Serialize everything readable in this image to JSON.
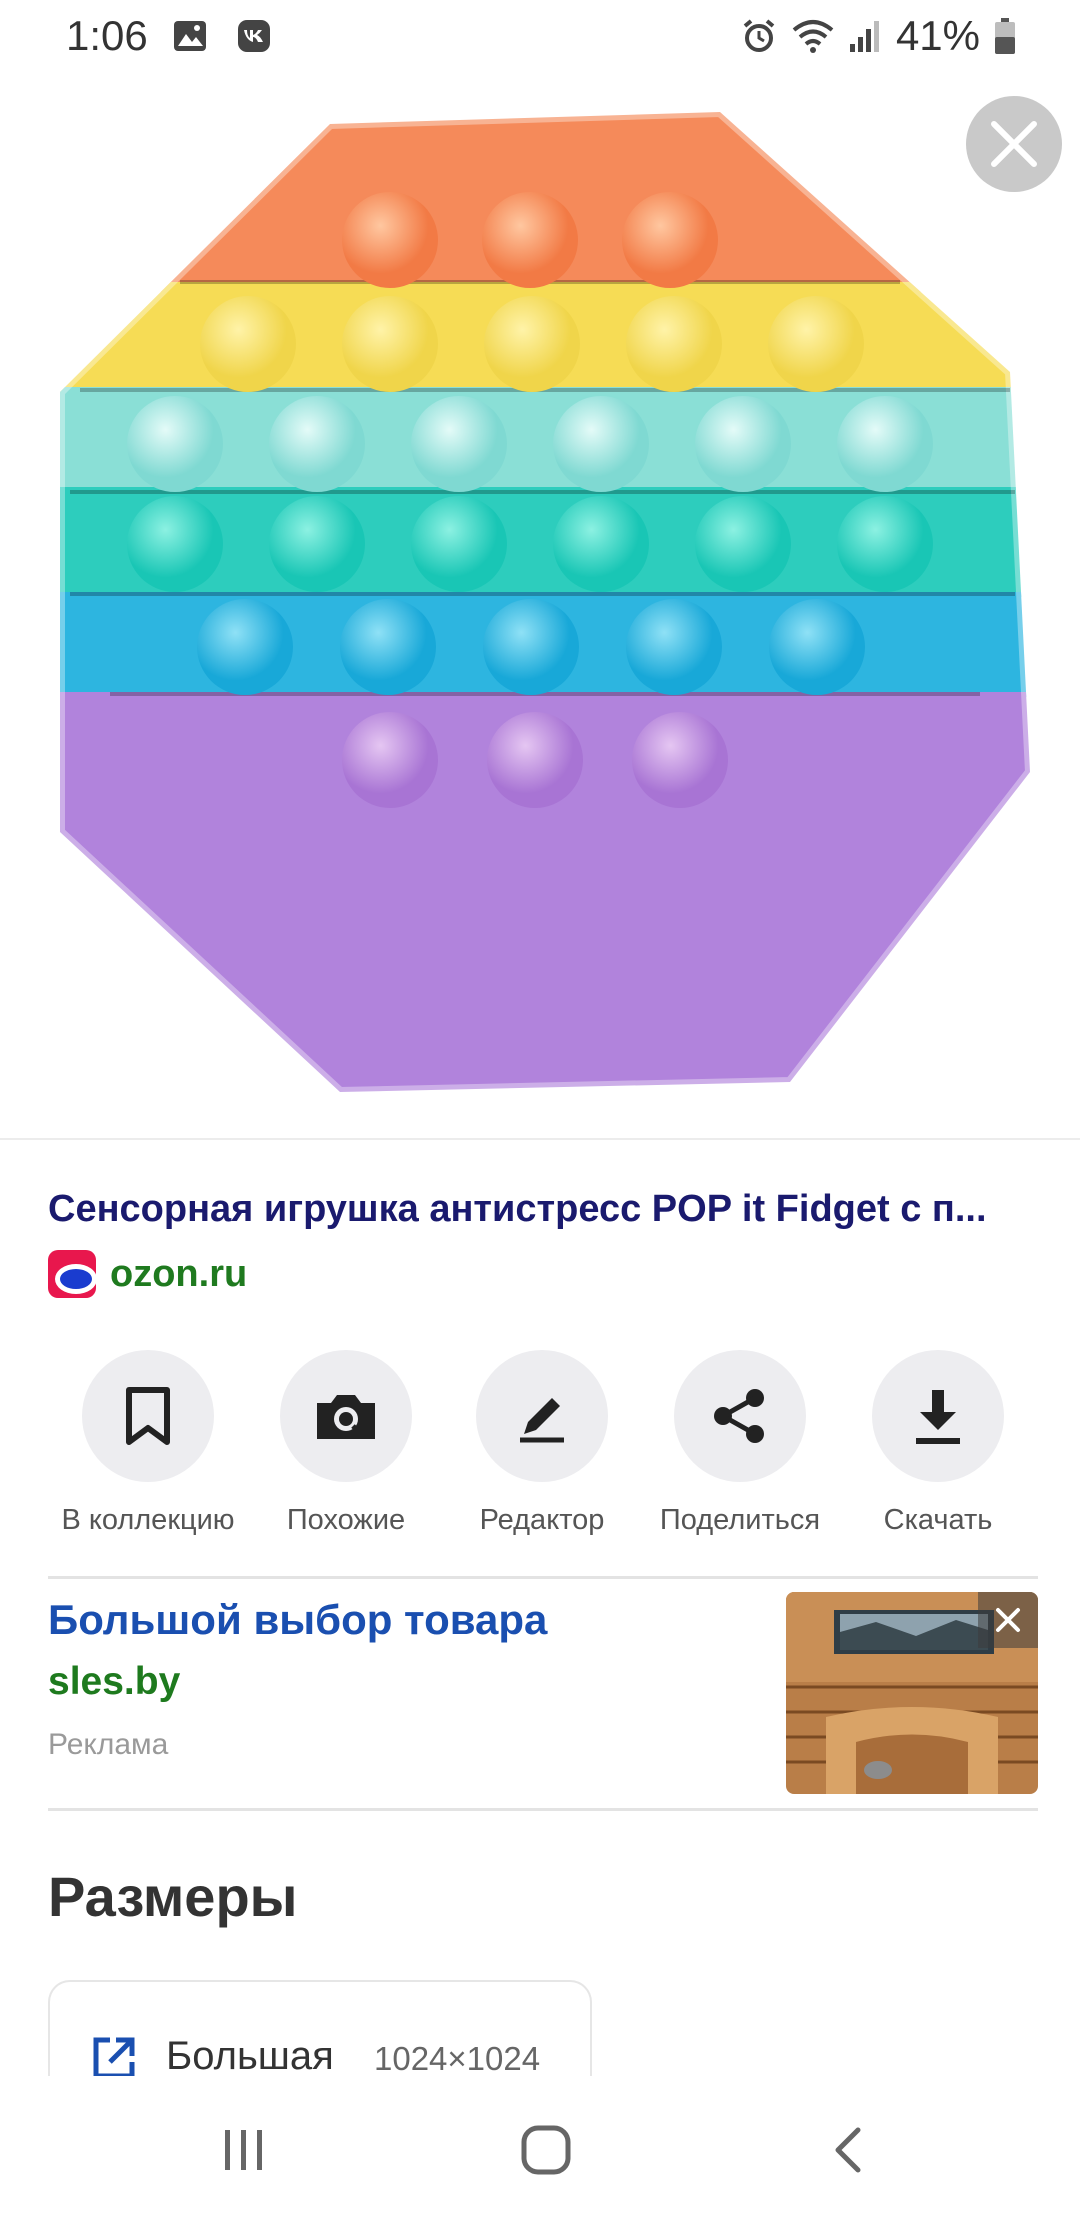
{
  "status_bar": {
    "time": "1:06",
    "battery": "41%"
  },
  "result": {
    "title": "Сенсорная игрушка антистресс POP it Fidget с п...",
    "source": "ozon.ru"
  },
  "actions": [
    {
      "label": "В коллекцию",
      "icon": "bookmark-icon"
    },
    {
      "label": "Похожие",
      "icon": "camera-search-icon"
    },
    {
      "label": "Редактор",
      "icon": "pencil-icon"
    },
    {
      "label": "Поделиться",
      "icon": "share-icon"
    },
    {
      "label": "Скачать",
      "icon": "download-icon"
    }
  ],
  "ad": {
    "title": "Большой выбор товара",
    "domain": "sles.by",
    "label": "Реклама"
  },
  "sizes": {
    "title": "Размеры",
    "items": [
      {
        "name": "Большая",
        "dims": "1024×1024"
      }
    ]
  },
  "colors": {
    "title": "#1a1a6e",
    "source": "#1f7a1f",
    "ad_title": "#1a4fb0",
    "ad_domain": "#1e7a1e"
  }
}
